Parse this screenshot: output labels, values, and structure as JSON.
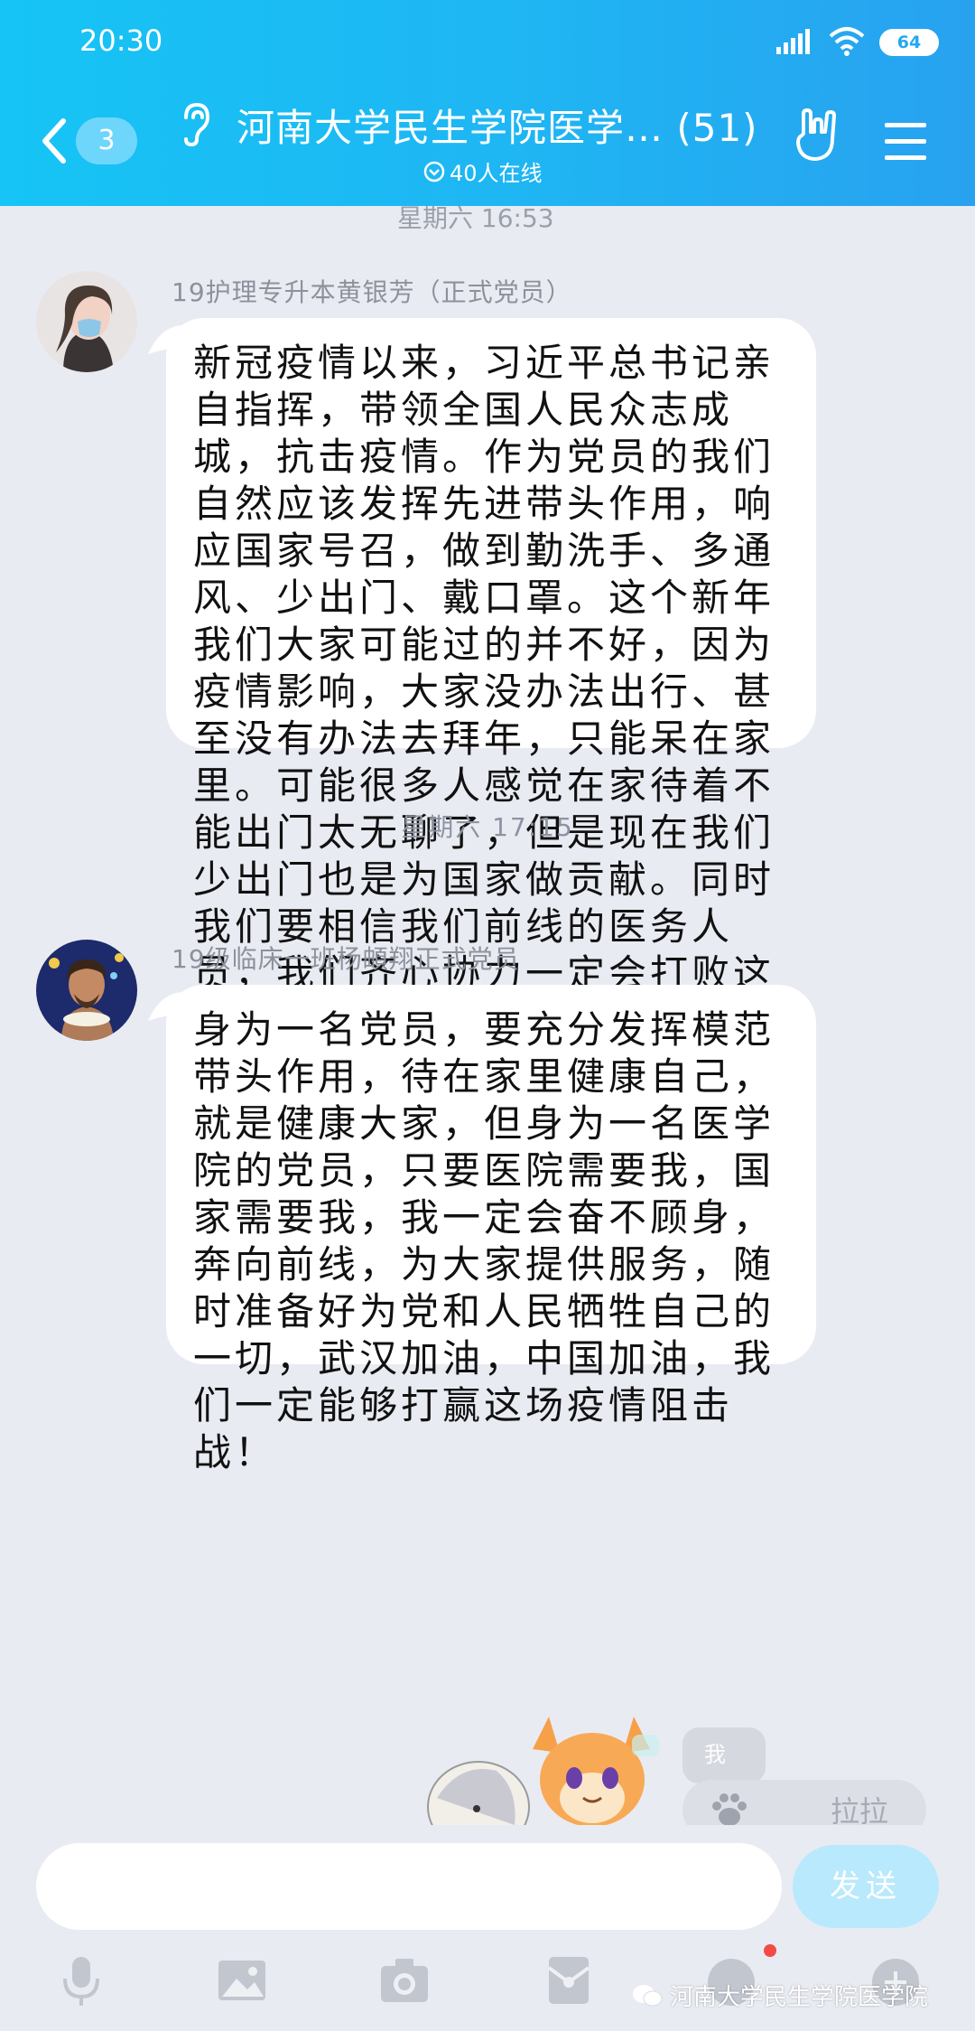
{
  "status_bar": {
    "time": "20:30",
    "battery": "64"
  },
  "header": {
    "unread_badge": "3",
    "title": "河南大学民生学院医学… (51)",
    "online": "40人在线"
  },
  "chat": {
    "cut_off_timestamp": "星期六 16:53",
    "messages": [
      {
        "sender": "19护理专升本黄银芳（正式党员）",
        "text": "新冠疫情以来，习近平总书记亲自指挥，带领全国人民众志成城，抗击疫情。作为党员的我们自然应该发挥先进带头作用，响应国家号召，做到勤洗手、多通风、少出门、戴口罩。这个新年我们大家可能过的并不好，因为疫情影响，大家没办法出行、甚至没有办法去拜年，只能呆在家里。可能很多人感觉在家待着不能出门太无聊了，但是现在我们少出门也是为国家做贡献。同时我们要相信我们前线的医务人员，我们齐心协力一定会打败这个看不见的敌人。我们也一定会取得这场战“疫”的胜利。"
      },
      {
        "timestamp": "星期六 17:15",
        "sender": "19级临床一班杨頔翔正式党员",
        "text": "身为一名党员，要充分发挥模范带头作用，待在家里健康自己，就是健康大家，但身为一名医学院的党员，只要医院需要我，国家需要我，我一定会奋不顾身，奔向前线，为大家提供服务，随时准备好为党和人民牺牲自己的一切，武汉加油，中国加油，我们一定能够打赢这场疫情阻击战！"
      }
    ]
  },
  "floating": {
    "me_label": "我",
    "lala_label": "拉拉"
  },
  "input": {
    "placeholder": "",
    "send_label": "发送"
  },
  "watermark": "河南大学民生学院医学院",
  "colors": {
    "header_start": "#16c4f5",
    "header_end": "#28a2ef",
    "background": "#e9ebf2",
    "send_button": "#b9e9fc"
  }
}
